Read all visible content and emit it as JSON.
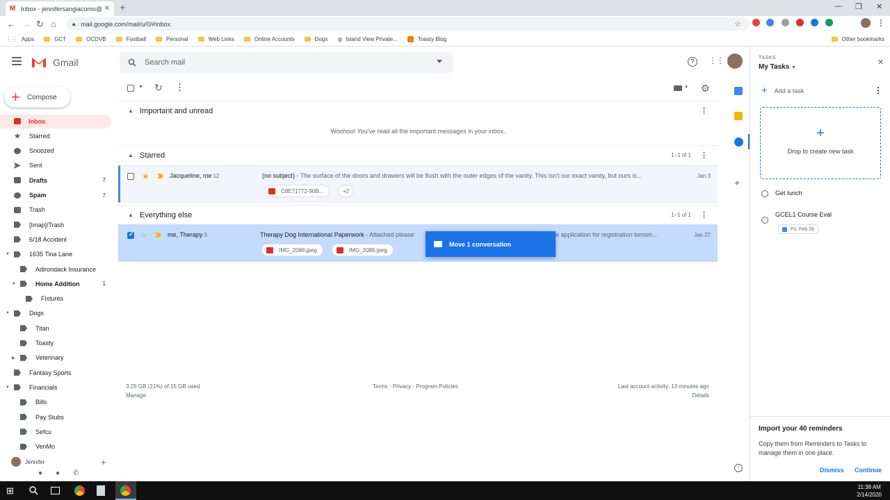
{
  "browser": {
    "tab_title": "Inbox - jennifersangiacomo@gm",
    "url": "mail.google.com/mail/u/0/#inbox",
    "bookmarks": [
      "Apps",
      "GCT",
      "OCDVB",
      "Football",
      "Personal",
      "Web Links",
      "Online Accounts",
      "Dogs",
      "Island View Private...",
      "Toasty Blog"
    ],
    "other_bookmarks": "Other bookmarks"
  },
  "gmail": {
    "app_name": "Gmail",
    "search_placeholder": "Search mail",
    "compose": "Compose"
  },
  "sidebar": {
    "items": [
      {
        "label": "Inbox",
        "count": ""
      },
      {
        "label": "Starred",
        "count": ""
      },
      {
        "label": "Snoozed",
        "count": ""
      },
      {
        "label": "Sent",
        "count": ""
      },
      {
        "label": "Drafts",
        "count": "7"
      },
      {
        "label": "Spam",
        "count": "7"
      },
      {
        "label": "Trash",
        "count": ""
      },
      {
        "label": "[Imap]/Trash",
        "count": ""
      },
      {
        "label": "6/18 Accident",
        "count": ""
      },
      {
        "label": "1635 Tina Lane",
        "count": ""
      },
      {
        "label": "Adirondack Insurance",
        "count": ""
      },
      {
        "label": "Home Addition",
        "count": "1"
      },
      {
        "label": "Fixtures",
        "count": ""
      },
      {
        "label": "Dogs",
        "count": ""
      },
      {
        "label": "Titan",
        "count": ""
      },
      {
        "label": "Toasty",
        "count": ""
      },
      {
        "label": "Veterinary",
        "count": ""
      },
      {
        "label": "Fantasy Sports",
        "count": ""
      },
      {
        "label": "Financials",
        "count": ""
      },
      {
        "label": "Bills",
        "count": ""
      },
      {
        "label": "Pay Stubs",
        "count": ""
      },
      {
        "label": "Sefcu",
        "count": ""
      },
      {
        "label": "VenMo",
        "count": ""
      }
    ],
    "user": "Jennifer"
  },
  "sections": {
    "important": {
      "title": "Important and unread",
      "empty": "Woohoo! You've read all the important messages in your inbox."
    },
    "starred": {
      "title": "Starred",
      "range": "1–1 of 1"
    },
    "everything": {
      "title": "Everything else",
      "range": "1–1 of 1"
    }
  },
  "emails": {
    "starred": {
      "sender": "Jacqueline, me",
      "count": "12",
      "subject": "(no subject)",
      "snippet": " - The surface of the doors and drawers will be flush with the outer edges of the vanity. This isn't our exact vanity, but ours is...",
      "date": "Jan 3",
      "attachment": "C8E71772-90B...",
      "more": "+2"
    },
    "everything": {
      "sender": "me, Therapy",
      "count": "3",
      "subject": "Therapy Dog International Paperwork",
      "snippet": " - Attached please",
      "snippet_tail": "e application for registration tomorr...",
      "date": "Jan 27",
      "attachments": [
        "IMG_2088.jpeg",
        "IMG_2089.jpeg"
      ]
    }
  },
  "drag_tooltip": "Move 1 conversation",
  "footer": {
    "storage": "3.25 GB (21%) of 15 GB used",
    "manage": "Manage",
    "links": "Terms · Privacy · Program Policies",
    "activity": "Last account activity: 13 minutes ago",
    "details": "Details"
  },
  "tasks": {
    "header": "TASKS",
    "list_name": "My Tasks",
    "add": "Add a task",
    "drop": "Drop to create new task",
    "items": [
      {
        "title": "Get lunch"
      },
      {
        "title": "GCEL1 Course Eval",
        "date": "Fri, Feb 28"
      }
    ],
    "import_title": "Import your 40 reminders",
    "import_body": "Copy them from Reminders to Tasks to manage them in one place.",
    "dismiss": "Dismiss",
    "continue": "Continue"
  },
  "taskbar": {
    "time": "11:38 AM",
    "date": "2/14/2020"
  },
  "colors": {
    "accent": "#1a73e8",
    "gmail_red": "#d93025",
    "selected_row": "#c2dbff"
  }
}
